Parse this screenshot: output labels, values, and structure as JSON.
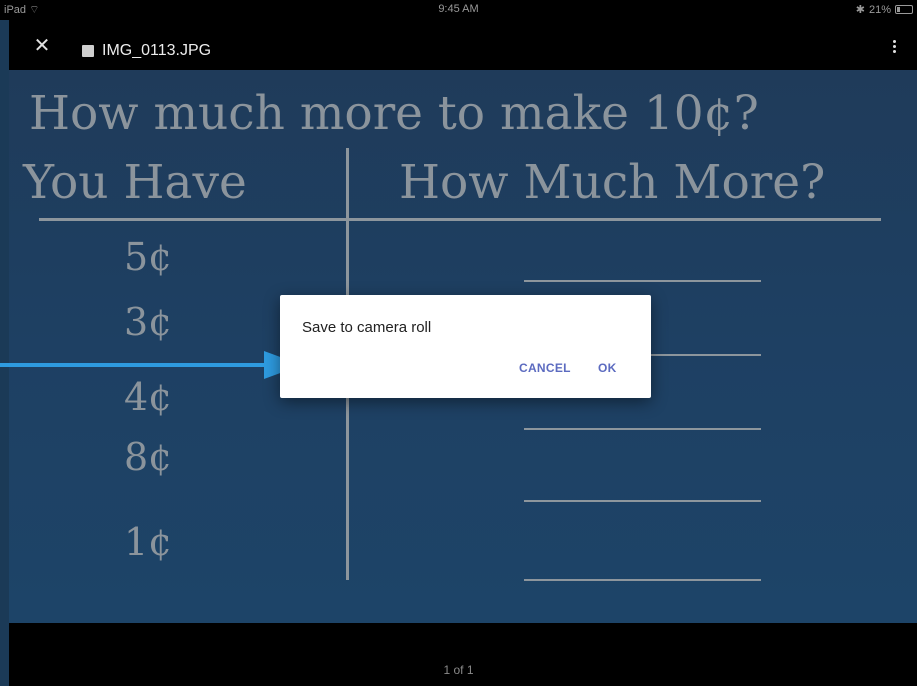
{
  "status_bar": {
    "device": "iPad",
    "time": "9:45 AM",
    "battery": "21%",
    "battery_level": 0.21
  },
  "app_bar": {
    "title": "IMG_0113.JPG",
    "close_icon": "close-icon",
    "image_icon": "image-icon",
    "more_icon": "more-vert-icon"
  },
  "photo": {
    "headline": "How much more to make 10¢?",
    "col_have": "You Have",
    "col_more": "How Much More?",
    "amounts": [
      "5¢",
      "3¢",
      "4¢",
      "8¢",
      "1¢"
    ]
  },
  "dialog": {
    "title": "Save to camera roll",
    "cancel": "CANCEL",
    "ok": "OK"
  },
  "pager": "1 of 1",
  "colors": {
    "accent": "#5c6bc0",
    "arrow": "#2e9be0",
    "photo_bg": "#1e4063"
  }
}
